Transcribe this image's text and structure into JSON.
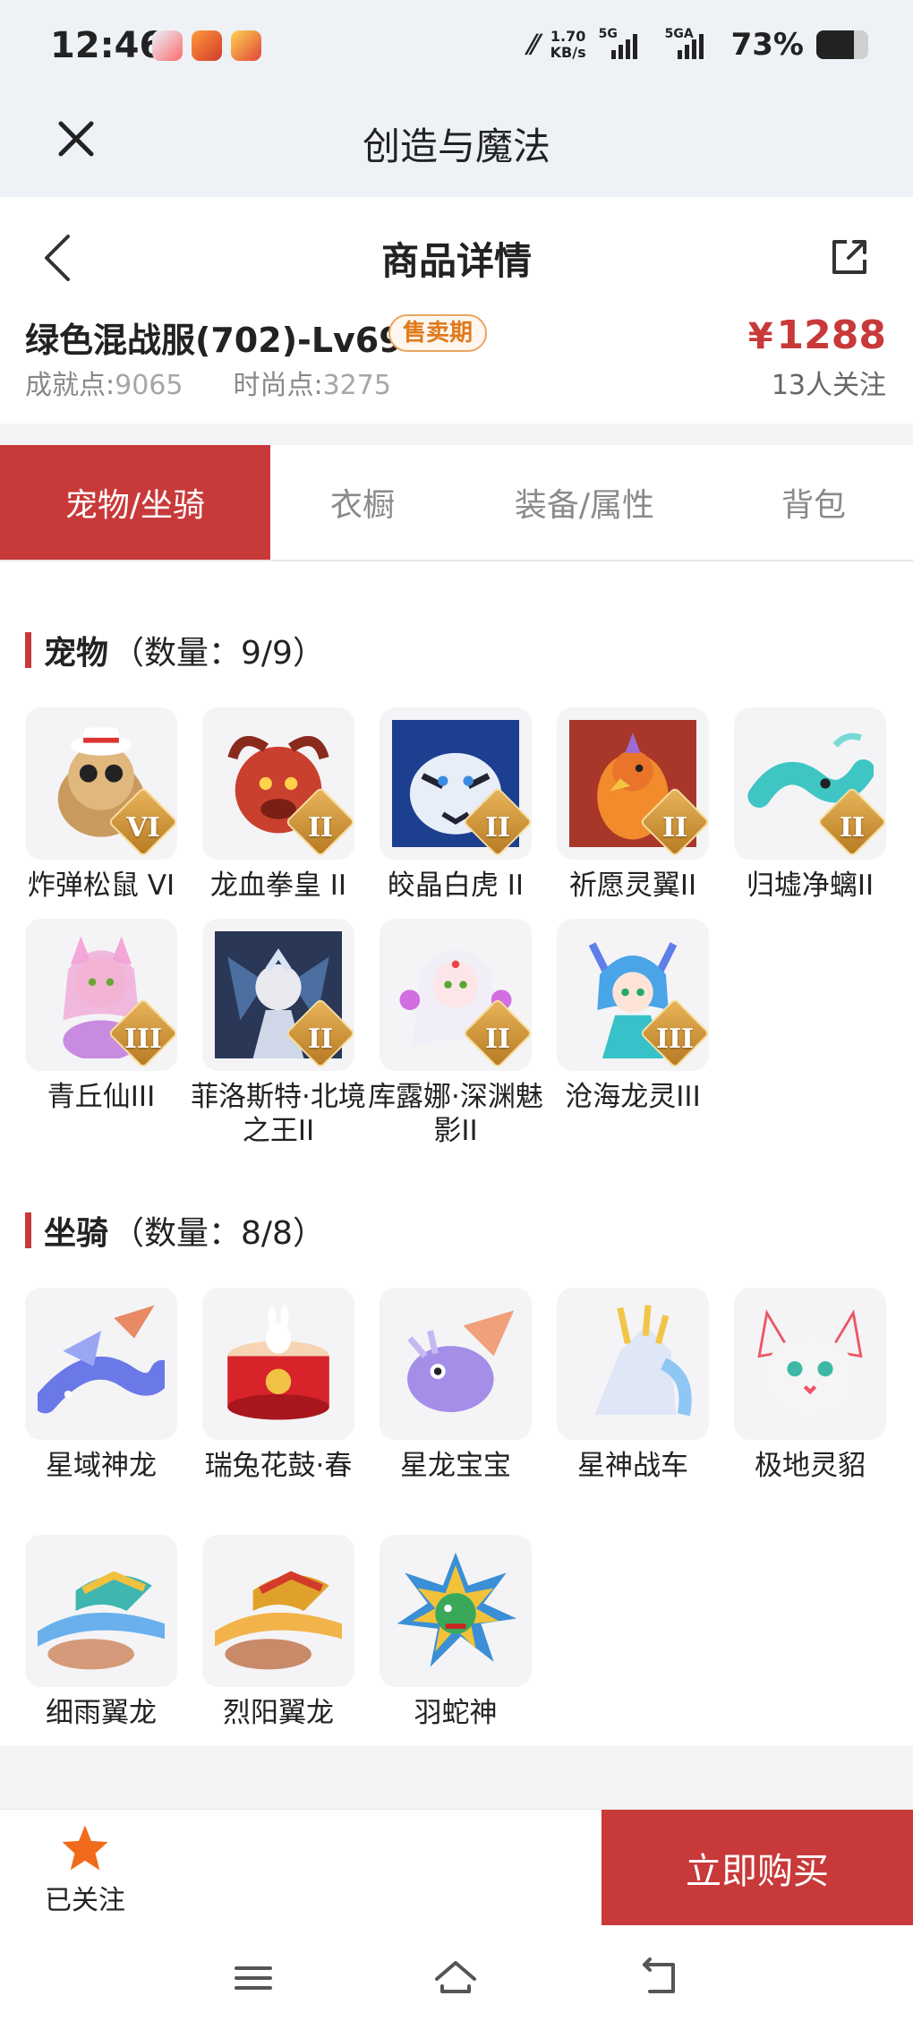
{
  "status_bar": {
    "time": "12:46",
    "speed_value": "1.70",
    "speed_unit": "KB/s",
    "net1": "5G",
    "net2": "5GA",
    "battery": "73%",
    "battery_level": 0.73
  },
  "app_header": {
    "title": "创造与魔法",
    "close_icon": "close-icon"
  },
  "nav": {
    "title": "商品详情",
    "back_icon": "back-arrow-icon",
    "share_icon": "share-icon"
  },
  "product": {
    "name": "绿色混战服(702)-Lv69",
    "badge": "售卖期",
    "achievement_label": "成就点:",
    "achievement_value": "9065",
    "fashion_label": "时尚点:",
    "fashion_value": "3275",
    "price_symbol": "¥",
    "price": "1288",
    "followers": "13人关注"
  },
  "tabs": [
    "宠物/坐骑",
    "衣橱",
    "装备/属性",
    "背包"
  ],
  "pets": {
    "title": "宠物",
    "count": "（数量：9/9）",
    "items": [
      {
        "name": "炸弹松鼠 VI",
        "tier": "VI"
      },
      {
        "name": "龙血拳皇 II",
        "tier": "II"
      },
      {
        "name": "皎晶白虎 II",
        "tier": "II"
      },
      {
        "name": "祈愿灵翼II",
        "tier": "II"
      },
      {
        "name": "归墟净螭II",
        "tier": "II"
      },
      {
        "name": "青丘仙III",
        "tier": "III"
      },
      {
        "name": "菲洛斯特·北境之王II",
        "tier": "II"
      },
      {
        "name": "库露娜·深渊魅影II",
        "tier": "II"
      },
      {
        "name": "沧海龙灵III",
        "tier": "III"
      }
    ]
  },
  "mounts": {
    "title": "坐骑",
    "count": "（数量：8/8）",
    "items": [
      {
        "name": "星域神龙"
      },
      {
        "name": "瑞兔花鼓·春"
      },
      {
        "name": "星龙宝宝"
      },
      {
        "name": "星神战车"
      },
      {
        "name": "极地灵貂"
      },
      {
        "name": "细雨翼龙"
      },
      {
        "name": "烈阳翼龙"
      },
      {
        "name": "羽蛇神"
      }
    ]
  },
  "bottom_bar": {
    "follow_label": "已关注",
    "buy_label": "立即购买",
    "accent": "#c8393a"
  },
  "system_nav": {
    "menu_icon": "menu-icon",
    "home_icon": "home-icon",
    "back_icon": "back-icon"
  }
}
